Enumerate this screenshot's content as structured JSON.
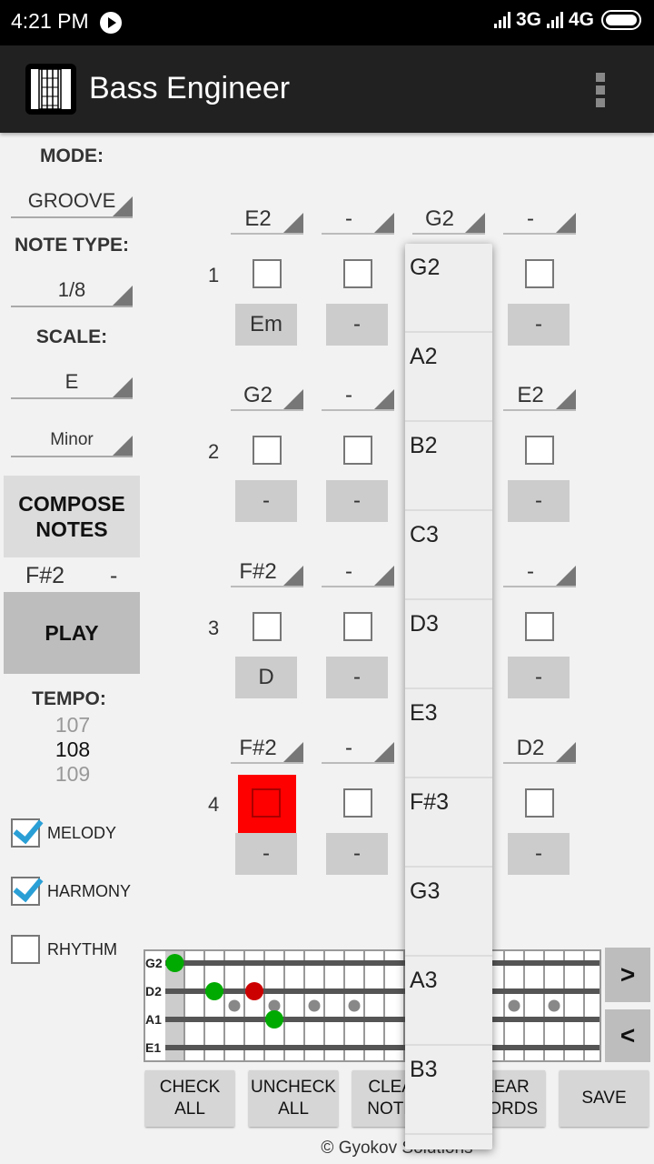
{
  "status_bar": {
    "time": "4:21 PM",
    "network_1": "3G",
    "network_2": "4G"
  },
  "app_bar": {
    "title": "Bass Engineer"
  },
  "left_panel": {
    "mode_label": "MODE:",
    "mode_value": "GROOVE",
    "note_type_label": "NOTE TYPE:",
    "note_type_value": "1/8",
    "scale_label": "SCALE:",
    "scale_root": "E",
    "scale_type": "Minor",
    "compose_button": "COMPOSE NOTES",
    "current_note": "F#2",
    "current_chord": "-",
    "play_button": "PLAY",
    "tempo_label": "TEMPO:",
    "tempo_prev": "107",
    "tempo_value": "108",
    "tempo_next": "109",
    "checkboxes": [
      {
        "label": "MELODY",
        "checked": true
      },
      {
        "label": "HARMONY",
        "checked": true
      },
      {
        "label": "RHYTHM",
        "checked": false
      }
    ]
  },
  "grid": {
    "measures": [
      {
        "number": "1",
        "notes": [
          "E2",
          "-",
          "G2",
          "-"
        ],
        "chords": [
          "Em",
          "-",
          "-",
          "-"
        ],
        "highlighted": [
          false,
          false,
          false,
          false
        ]
      },
      {
        "number": "2",
        "notes": [
          "G2",
          "-",
          "",
          "E2"
        ],
        "chords": [
          "-",
          "-",
          "",
          "-"
        ],
        "highlighted": [
          false,
          false,
          false,
          false
        ]
      },
      {
        "number": "3",
        "notes": [
          "F#2",
          "-",
          "",
          "-"
        ],
        "chords": [
          "D",
          "-",
          "",
          "-"
        ],
        "highlighted": [
          false,
          false,
          false,
          false
        ]
      },
      {
        "number": "4",
        "notes": [
          "F#2",
          "-",
          "",
          "D2"
        ],
        "chords": [
          "-",
          "-",
          "",
          "-"
        ],
        "highlighted": [
          true,
          false,
          false,
          false
        ]
      }
    ]
  },
  "dropdown": {
    "options": [
      "G2",
      "A2",
      "B2",
      "C3",
      "D3",
      "E3",
      "F#3",
      "G3",
      "A3",
      "B3"
    ]
  },
  "fretboard": {
    "strings": [
      "G2",
      "D2",
      "A1",
      "E1"
    ],
    "fret_count": 21,
    "markers": [
      {
        "string": "G2",
        "fret": 0,
        "color": "#00aa00"
      },
      {
        "string": "D2",
        "fret": 2,
        "color": "#00aa00"
      },
      {
        "string": "D2",
        "fret": 4,
        "color": "#cc0000"
      },
      {
        "string": "A1",
        "fret": 5,
        "color": "#00aa00"
      }
    ],
    "inlay_frets": [
      3,
      5,
      7,
      9,
      12,
      15,
      17,
      19
    ],
    "next_button": ">",
    "prev_button": "<"
  },
  "bottom_buttons": {
    "check_all": "CHECK ALL",
    "uncheck_all": "UNCHECK ALL",
    "clear_notes": "CLEAR NOTES",
    "clear_chords": "CLEAR CHORDS",
    "save": "SAVE"
  },
  "footer": "© Gyokov Solutions"
}
